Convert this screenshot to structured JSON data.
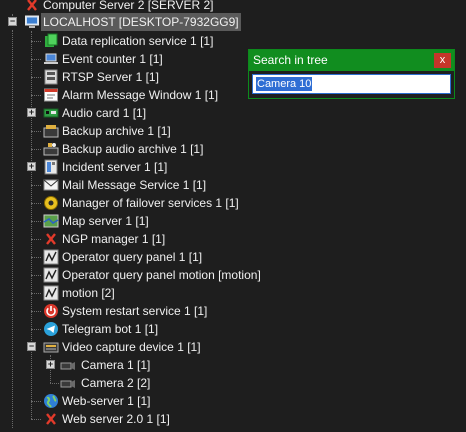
{
  "tree": {
    "items": [
      {
        "label": "Computer Server 2 [SERVER 2]",
        "icon": "red-x-icon"
      },
      {
        "label": "LOCALHOST [DESKTOP-7932GG9]",
        "icon": "computer-icon",
        "selected": true,
        "expanded": true
      },
      {
        "label": "Data replication service 1 [1]",
        "icon": "replication-icon"
      },
      {
        "label": "Event counter 1 [1]",
        "icon": "laptop-icon"
      },
      {
        "label": "RTSP Server 1 [1]",
        "icon": "rtsp-server-icon"
      },
      {
        "label": "Alarm Message Window 1 [1]",
        "icon": "alarm-window-icon"
      },
      {
        "label": "Audio card 1 [1]",
        "icon": "audio-card-icon",
        "expandable": true
      },
      {
        "label": "Backup archive 1 [1]",
        "icon": "archive-icon"
      },
      {
        "label": "Backup audio archive 1 [1]",
        "icon": "audio-archive-icon"
      },
      {
        "label": "Incident server 1 [1]",
        "icon": "incident-server-icon",
        "expandable": true
      },
      {
        "label": "Mail Message Service 1 [1]",
        "icon": "mail-icon"
      },
      {
        "label": "Manager of failover services 1 [1]",
        "icon": "failover-icon"
      },
      {
        "label": "Map server 1 [1]",
        "icon": "map-server-icon"
      },
      {
        "label": "NGP manager 1 [1]",
        "icon": "red-x-icon"
      },
      {
        "label": "Operator query panel 1 [1]",
        "icon": "query-panel-icon"
      },
      {
        "label": "Operator query panel motion [motion]",
        "icon": "query-panel-icon"
      },
      {
        "label": "motion [2]",
        "icon": "query-panel-icon"
      },
      {
        "label": "System restart service 1 [1]",
        "icon": "power-icon"
      },
      {
        "label": "Telegram bot 1 [1]",
        "icon": "telegram-icon"
      },
      {
        "label": "Video capture device 1 [1]",
        "icon": "capture-device-icon",
        "expanded": true
      },
      {
        "label": "Camera 1 [1]",
        "icon": "camera-icon",
        "expandable": true
      },
      {
        "label": "Camera 2 [2]",
        "icon": "camera-icon"
      },
      {
        "label": "Web-server 1 [1]",
        "icon": "globe-icon"
      },
      {
        "label": "Web server 2.0 1 [1]",
        "icon": "red-x-icon"
      }
    ]
  },
  "search": {
    "title": "Search in tree",
    "close_label": "x",
    "value": "Camera 10"
  },
  "colors": {
    "background": "#1e1e1e",
    "search_title_bar": "#118d1f",
    "close_button": "#c5362a",
    "input_selection": "#2f6ed4",
    "selected_row": "#5a5a5a"
  }
}
